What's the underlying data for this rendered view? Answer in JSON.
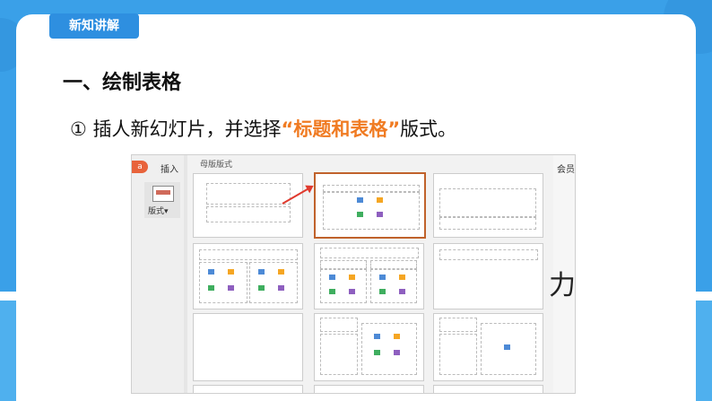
{
  "tag": {
    "label": "新知讲解"
  },
  "heading": "一、绘制表格",
  "instruction": {
    "num": "①",
    "prefix": " 插人新幻灯片，并选择",
    "highlight": "“标题和表格”",
    "suffix": "版式。"
  },
  "screenshot": {
    "badge": "a",
    "insert_tab": "插入",
    "layout_button": "版式",
    "member_label": "会员",
    "panel_title": "母版版式",
    "right_glyph": "力"
  },
  "colors": {
    "accent": "#f07b22",
    "tag_bg": "#2e8fe0",
    "selected_border": "#c0622b"
  }
}
